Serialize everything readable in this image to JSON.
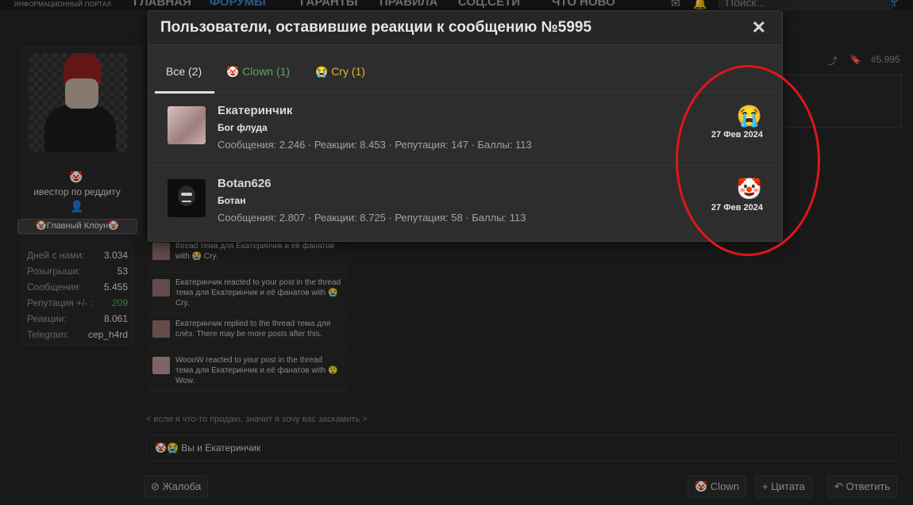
{
  "topnav": {
    "logo_sub": "ИНФОРМАЦИОННЫЙ ПОРТАЛ",
    "items": [
      "ГЛАВНАЯ",
      "ФОРУМЫ",
      "ГАРАНТЫ",
      "ПРАВИЛА",
      "СОЦ.СЕТИ",
      "ЧТО НОВО"
    ],
    "search_placeholder": "Поиск..."
  },
  "user_card": {
    "title_icon": "🤡",
    "title": "ивестор по реддиту",
    "badge": "🤡Главный Клоун🤡",
    "stats": [
      {
        "k": "Дней с нами:",
        "v": "3.034"
      },
      {
        "k": "Розыгрыши:",
        "v": "53"
      },
      {
        "k": "Сообщения:",
        "v": "5.455"
      },
      {
        "k": "Репутация +/- :",
        "v": "209"
      },
      {
        "k": "Реакции:",
        "v": "8.061"
      },
      {
        "k": "Telegram:",
        "v": "cep_h4rd"
      }
    ]
  },
  "post": {
    "number": "#5.995"
  },
  "alerts": [
    {
      "text": "thread тема для Екатеринчик и её фанатов with 😭 Cry."
    },
    {
      "text": "Екатеринчик reacted to your post in the thread тема для Екатеринчик и её фанатов with 😭 Cry."
    },
    {
      "text": "Екатеринчик replied to the thread тема для слёз. There may be more posts after this."
    },
    {
      "text": "WoooW reacted to your post in the thread тема для Екатеринчик и её фанатов with 😲 Wow."
    }
  ],
  "signature": "< если я что-то продаю, значит я хочу вас заскамить >",
  "reactions_bar": "🤡😭 Вы и Екатеринчик",
  "buttons": {
    "report": "⊘ Жалоба",
    "clown": "🤡 Clown",
    "quote": "+ Цитата",
    "reply": "↶ Ответить"
  },
  "modal": {
    "title": "Пользователи, оставившие реакции к сообщению №5995",
    "close": "✕",
    "tabs": {
      "all": "Все (2)",
      "clown_icon": "🤡",
      "clown": "Clown (1)",
      "cry_icon": "😭",
      "cry": "Cry (1)"
    },
    "reactors": [
      {
        "name": "Екатеринчик",
        "title": "Бог флуда",
        "stats": "Сообщения: 2.246 · Реакции: 8.453 · Репутация: 147 · Баллы: 113",
        "emoji": "😭",
        "date": "27 Фев 2024"
      },
      {
        "name": "Botan626",
        "title": "Ботан",
        "stats": "Сообщения: 2.807 · Реакции: 8.725 · Репутация: 58 · Баллы: 113",
        "emoji": "🤡",
        "date": "27 Фев 2024"
      }
    ]
  },
  "colors": {
    "annotation": "#e0161c",
    "accent": "#3a83c8"
  }
}
